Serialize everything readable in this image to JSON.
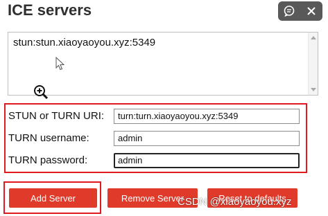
{
  "title": "ICE servers",
  "controls": [
    {
      "icon": "chat-icon"
    },
    {
      "icon": "close-icon"
    }
  ],
  "server_list": {
    "entries": [
      "stun:stun.xiaoyaoyou.xyz:5349"
    ]
  },
  "form": {
    "uri_label": "STUN or TURN URI:",
    "uri_value": "turn:turn.xiaoyaoyou.xyz:5349",
    "username_label": "TURN username:",
    "username_value": "admin",
    "password_label": "TURN password:",
    "password_value": "admin"
  },
  "buttons": {
    "add": "Add Server",
    "remove": "Remove Server",
    "reset": "Reset to defaults"
  },
  "watermark": "CSDN @xiaoyaoyou.xyz",
  "colors": {
    "accent": "#e03a2a",
    "highlight_border": "#e0191e",
    "control_bg": "#595959"
  }
}
